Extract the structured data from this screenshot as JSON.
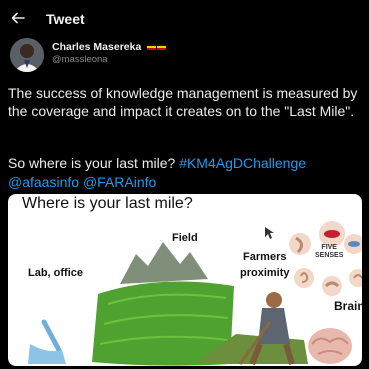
{
  "header": {
    "title": "Tweet",
    "back_icon": "arrow-left-icon"
  },
  "author": {
    "name": "Charles Masereka",
    "handle": "@massleona",
    "flag_colors": [
      "#111111",
      "#f7d000",
      "#d90000"
    ]
  },
  "tweet": {
    "text": "The success of knowledge management is measured by the coverage and impact it creates on to the \"Last Mile\".",
    "question": "So where is your last mile?",
    "hashtag": "#KM4AgDChallenge",
    "mention_1": "@afaasinfo",
    "mention_2": "@FARAinfo"
  },
  "media": {
    "title": "Where is your last mile?",
    "labels": {
      "lab": "Lab, office",
      "field": "Field",
      "farmers": "Farmers\nproximity",
      "brain": "Brain"
    },
    "five_senses": "FIVE\nSENSES"
  },
  "colors": {
    "background": "#000000",
    "link": "#1d9bf0",
    "text": "#ececec"
  }
}
